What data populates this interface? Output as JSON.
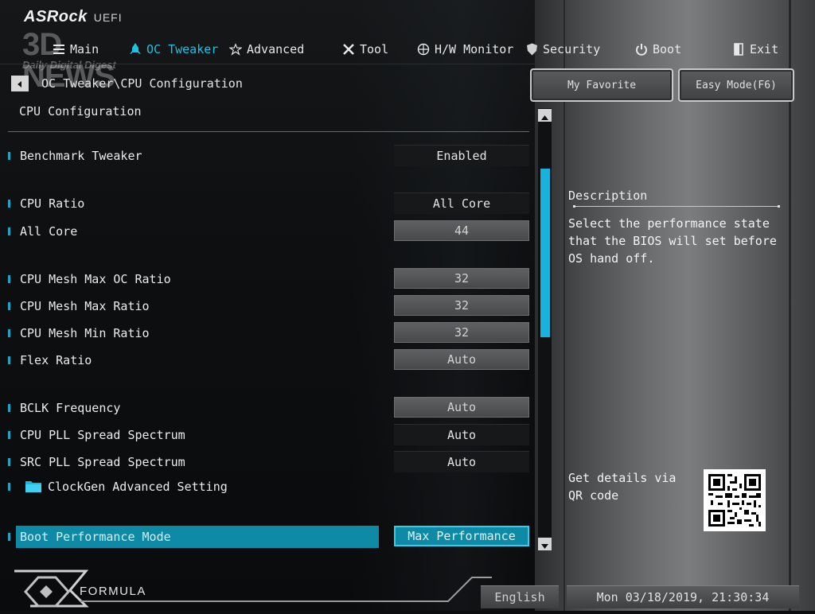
{
  "brand": {
    "logo": "ASRock",
    "sub": "UEFI"
  },
  "watermark": {
    "big": "3D NEWS",
    "small": "Daily Digital Digest"
  },
  "nav": {
    "items": [
      {
        "label": "Main",
        "icon": "list-icon",
        "active": false
      },
      {
        "label": "OC Tweaker",
        "icon": "rocket-icon",
        "active": true
      },
      {
        "label": "Advanced",
        "icon": "star-icon",
        "active": false
      },
      {
        "label": "Tool",
        "icon": "tools-icon",
        "active": false
      },
      {
        "label": "H/W Monitor",
        "icon": "crosshair-icon",
        "active": false
      },
      {
        "label": "Security",
        "icon": "shield-icon",
        "active": false
      },
      {
        "label": "Boot",
        "icon": "power-icon",
        "active": false
      },
      {
        "label": "Exit",
        "icon": "exit-door-icon",
        "active": false
      }
    ]
  },
  "breadcrumb": "OC Tweaker\\CPU Configuration",
  "page_title": "CPU Configuration",
  "buttons": {
    "favorite": "My Favorite",
    "easy_mode": "Easy Mode(F6)"
  },
  "settings": [
    {
      "label": "Benchmark Tweaker",
      "value": "Enabled",
      "kind": "dropdown"
    },
    {
      "label": "CPU Ratio",
      "value": "All Core",
      "kind": "dropdown"
    },
    {
      "label": "All Core",
      "value": "44",
      "kind": "numeric"
    },
    {
      "label": "CPU Mesh Max OC Ratio",
      "value": "32",
      "kind": "numeric"
    },
    {
      "label": "CPU Mesh Max Ratio",
      "value": "32",
      "kind": "numeric"
    },
    {
      "label": "CPU Mesh Min Ratio",
      "value": "32",
      "kind": "numeric"
    },
    {
      "label": "Flex Ratio",
      "value": "Auto",
      "kind": "numeric"
    },
    {
      "label": "BCLK Frequency",
      "value": "Auto",
      "kind": "numeric"
    },
    {
      "label": "CPU PLL Spread Spectrum",
      "value": "Auto",
      "kind": "dropdown"
    },
    {
      "label": "SRC PLL Spread Spectrum",
      "value": "Auto",
      "kind": "dropdown"
    },
    {
      "label": "ClockGen Advanced Setting",
      "value": "",
      "kind": "folder"
    },
    {
      "label": "Boot Performance Mode",
      "value": "Max Performance",
      "kind": "selected"
    }
  ],
  "description": {
    "title": "Description",
    "text": "Select the performance state that the BIOS will set before OS hand off.",
    "qr_text": "Get details via QR code"
  },
  "footer": {
    "formula": "FORMULA",
    "language": "English",
    "datetime": "Mon 03/18/2019, 21:30:34"
  },
  "colors": {
    "accent": "#19c3e6",
    "highlight": "#0f8aa6"
  }
}
